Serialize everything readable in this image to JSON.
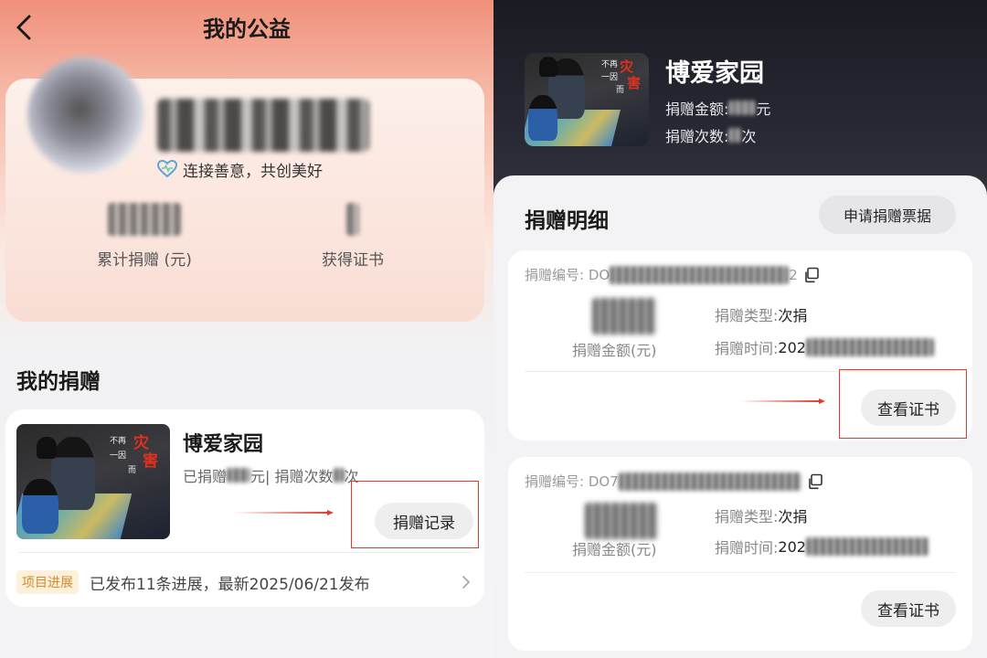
{
  "left": {
    "header": {
      "title": "我的公益"
    },
    "profile": {
      "slogan": "连接善意，共创美好",
      "stats": [
        {
          "label": "累计捐赠 (元)"
        },
        {
          "label": "获得证书"
        }
      ]
    },
    "section_title": "我的捐赠",
    "donation": {
      "project_title": "博爱家园",
      "donated_prefix": "已捐赠",
      "donated_unit": "元",
      "count_prefix": " | 捐赠次数",
      "count_unit": "次",
      "record_button": "捐赠记录",
      "progress_badge": "项目进展",
      "progress_text": "已发布11条进展，最新2025/06/21发布"
    },
    "thumb_text": {
      "a": "不再",
      "b": "一因",
      "c": "而",
      "d": "灾",
      "e": "害"
    }
  },
  "right": {
    "project": {
      "title": "博爱家园",
      "amount_label": "捐赠金额:",
      "amount_unit": "元",
      "count_label": "捐赠次数:",
      "count_unit": "次"
    },
    "detail_title": "捐赠明细",
    "receipt_button": "申请捐赠票据",
    "records": [
      {
        "no_label": "捐赠编号: DO",
        "no_suffix": "2",
        "amount_label": "捐赠金额(元)",
        "type_label": "捐赠类型: ",
        "type_value": "次捐",
        "time_label": "捐赠时间: ",
        "time_value": "202",
        "cert_button": "查看证书"
      },
      {
        "no_label": "捐赠编号: DO7",
        "no_suffix": "",
        "amount_label": "捐赠金额(元)",
        "type_label": "捐赠类型: ",
        "type_value": "次捐",
        "time_label": "捐赠时间: ",
        "time_value": "202",
        "cert_button": "查看证书"
      }
    ]
  },
  "colors": {
    "accent_red": "#e23b2e",
    "badge_bg": "#fdf1dc",
    "badge_text": "#d8882d"
  }
}
